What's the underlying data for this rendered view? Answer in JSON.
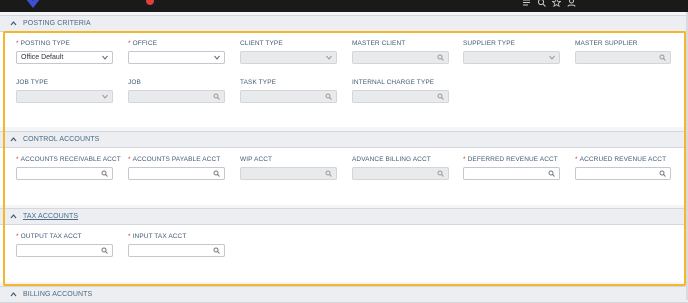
{
  "topbar": {
    "icons": [
      "list-icon",
      "search-icon",
      "star-icon",
      "user-icon"
    ]
  },
  "sections": {
    "posting_criteria": {
      "title": "POSTING CRITERIA",
      "fields": {
        "posting_type": {
          "label": "POSTING TYPE",
          "required": "*",
          "value": "Office Default"
        },
        "office": {
          "label": "OFFICE",
          "required": "*",
          "value": ""
        },
        "client_type": {
          "label": "CLIENT TYPE",
          "value": ""
        },
        "master_client": {
          "label": "MASTER CLIENT",
          "value": ""
        },
        "supplier_type": {
          "label": "SUPPLIER TYPE",
          "value": ""
        },
        "master_supplier": {
          "label": "MASTER SUPPLIER",
          "value": ""
        },
        "job_type": {
          "label": "JOB TYPE",
          "value": ""
        },
        "job": {
          "label": "JOB",
          "value": ""
        },
        "task_type": {
          "label": "TASK TYPE",
          "value": ""
        },
        "internal_charge_type": {
          "label": "INTERNAL CHARGE TYPE",
          "value": ""
        }
      }
    },
    "control_accounts": {
      "title": "CONTROL ACCOUNTS",
      "fields": {
        "ar_acct": {
          "label": "ACCOUNTS RECEIVABLE ACCT",
          "required": "*",
          "value": ""
        },
        "ap_acct": {
          "label": "ACCOUNTS PAYABLE ACCT",
          "required": "*",
          "value": ""
        },
        "wip_acct": {
          "label": "WIP ACCT",
          "value": ""
        },
        "advance_billing_acct": {
          "label": "ADVANCE BILLING ACCT",
          "value": ""
        },
        "deferred_revenue_acct": {
          "label": "DEFERRED REVENUE ACCT",
          "required": "*",
          "value": ""
        },
        "accrued_revenue_acct": {
          "label": "ACCRUED REVENUE ACCT",
          "required": "*",
          "value": ""
        }
      }
    },
    "tax_accounts": {
      "title": "TAX ACCOUNTS",
      "fields": {
        "output_tax_acct": {
          "label": "OUTPUT TAX ACCT",
          "required": "*",
          "value": ""
        },
        "input_tax_acct": {
          "label": "INPUT TAX ACCT",
          "required": "*",
          "value": ""
        }
      }
    },
    "billing_accounts": {
      "title": "BILLING ACCOUNTS"
    }
  },
  "colors": {
    "accent_highlight": "#f2b72a",
    "required": "#d33a2c",
    "label": "#3f5b76"
  }
}
